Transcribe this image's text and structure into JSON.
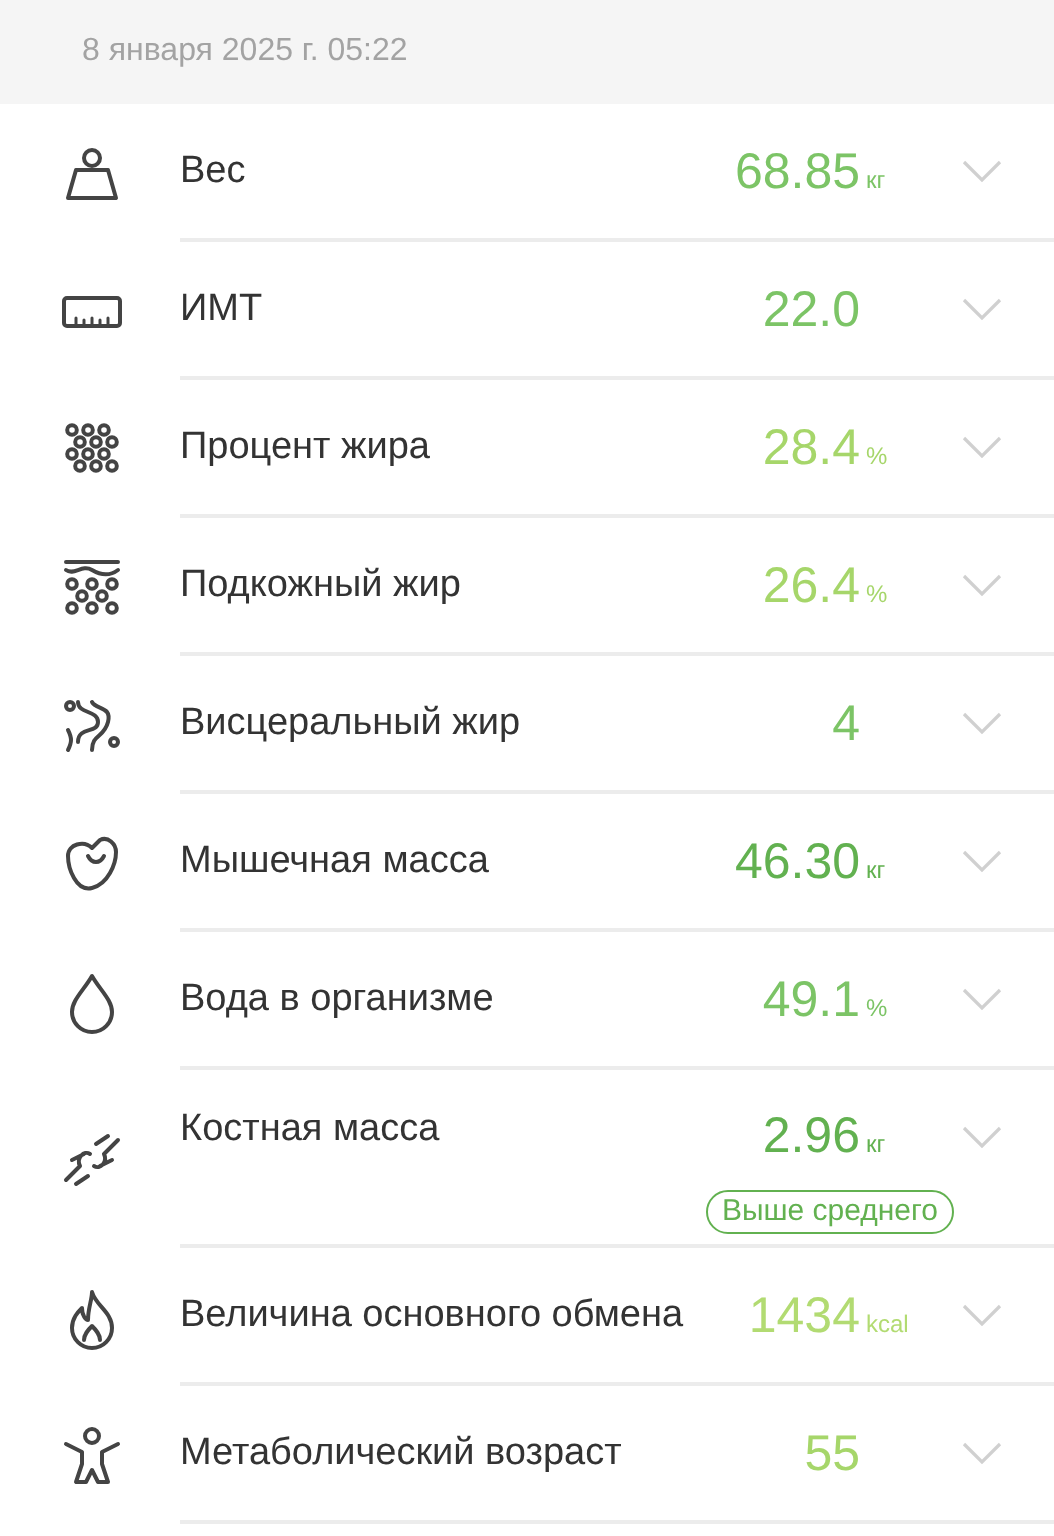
{
  "header": {
    "date": "8 января 2025 г. 05:22"
  },
  "metrics": [
    {
      "label": "Вес",
      "value": "68.85",
      "unit": "кг",
      "color": "#7cc466"
    },
    {
      "label": "ИМТ",
      "value": "22.0",
      "color": "#7cc466"
    },
    {
      "label": "Процент жира",
      "value": "28.4",
      "unit": "%",
      "color": "#a6d66a"
    },
    {
      "label": "Подкожный жир",
      "value": "26.4",
      "unit": "%",
      "color": "#a6d66a"
    },
    {
      "label": "Висцеральный жир",
      "value": "4",
      "color": "#7cc466"
    },
    {
      "label": "Мышечная масса",
      "value": "46.30",
      "unit": "кг",
      "color": "#62b150"
    },
    {
      "label": "Вода в организме",
      "value": "49.1",
      "unit": "%",
      "color": "#7cc466"
    },
    {
      "label": "Костная масса",
      "value": "2.96",
      "unit": "кг",
      "color": "#62b150",
      "badge": "Выше среднего"
    },
    {
      "label": "Величина основного обмена",
      "value": "1434",
      "unit": "kcal",
      "color": "#b2db72"
    },
    {
      "label": "Метаболический возраст",
      "value": "55",
      "color": "#a6d66a"
    }
  ]
}
